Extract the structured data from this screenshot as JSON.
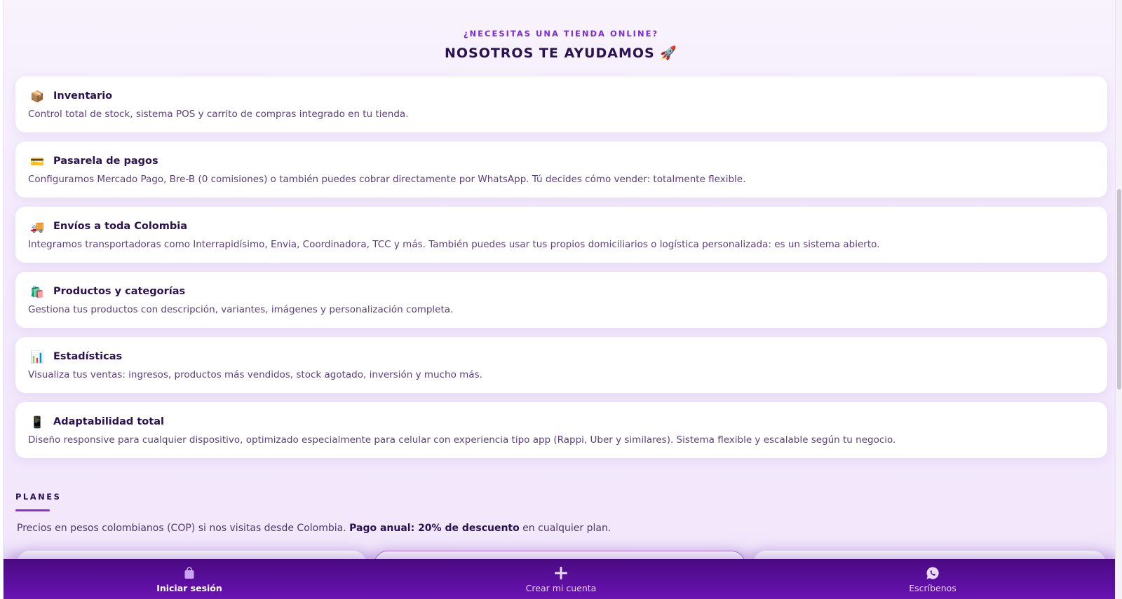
{
  "hero": {
    "eyebrow": "¿NECESITAS UNA TIENDA ONLINE?",
    "title": "NOSOTROS TE AYUDAMOS",
    "title_emoji": "🚀"
  },
  "features": [
    {
      "icon": "package-icon",
      "glyph": "📦",
      "title": "Inventario",
      "description": "Control total de stock, sistema POS y carrito de compras integrado en tu tienda."
    },
    {
      "icon": "credit-card-icon",
      "glyph": "💳",
      "title": "Pasarela de pagos",
      "description": "Configuramos Mercado Pago, Bre-B (0 comisiones) o también puedes cobrar directamente por WhatsApp. Tú decides cómo vender: totalmente flexible."
    },
    {
      "icon": "delivery-truck-icon",
      "glyph": "🚚",
      "title": "Envíos a toda Colombia",
      "description": "Integramos transportadoras como Interrapidísimo, Envia, Coordinadora, TCC y más. También puedes usar tus propios domiciliarios o logística personalizada: es un sistema abierto."
    },
    {
      "icon": "shopping-bags-icon",
      "glyph": "🛍️",
      "title": "Productos y categorías",
      "description": "Gestiona tus productos con descripción, variantes, imágenes y personalización completa."
    },
    {
      "icon": "bar-chart-icon",
      "glyph": "📊",
      "title": "Estadísticas",
      "description": "Visualiza tus ventas: ingresos, productos más vendidos, stock agotado, inversión y mucho más."
    },
    {
      "icon": "mobile-phone-icon",
      "glyph": "📱",
      "title": "Adaptabilidad total",
      "description": "Diseño responsive para cualquier dispositivo, optimizado especialmente para celular con experiencia tipo app (Rappi, Uber y similares). Sistema flexible y escalable según tu negocio."
    }
  ],
  "plans": {
    "label": "PLANES",
    "note_prefix": "Precios en pesos colombianos (COP) si nos visitas desde Colombia. ",
    "note_bold": "Pago anual: 20% de descuento",
    "note_suffix": " en cualquier plan."
  },
  "bottom_nav": {
    "items": [
      {
        "label": "Iniciar sesión",
        "icon": "shopping-bag-icon",
        "active": true
      },
      {
        "label": "Crear mi cuenta",
        "icon": "plus-icon",
        "active": false
      },
      {
        "label": "Escríbenos",
        "icon": "whatsapp-icon",
        "active": false
      }
    ]
  },
  "colors": {
    "accent": "#7b2fd0",
    "heading": "#2a1250",
    "nav_background": "#5c0fa0"
  }
}
